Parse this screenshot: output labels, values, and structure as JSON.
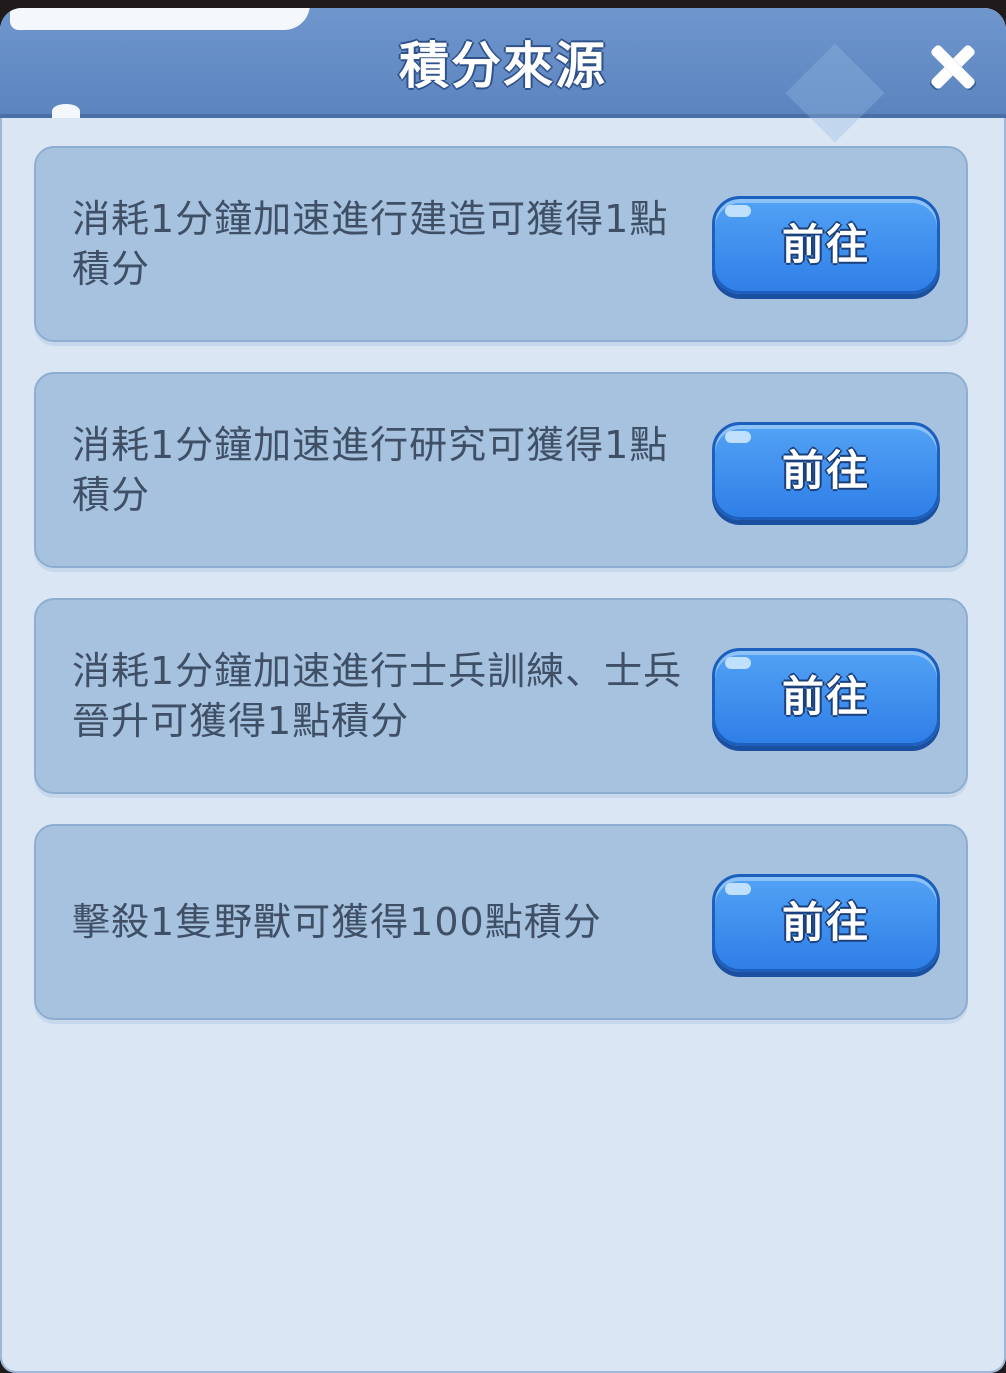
{
  "dialog": {
    "title": "積分來源",
    "close_icon": "close-icon"
  },
  "rows": [
    {
      "text": "消耗1分鐘加速進行建造可獲得1點積分",
      "button_label": "前往"
    },
    {
      "text": "消耗1分鐘加速進行研究可獲得1點積分",
      "button_label": "前往"
    },
    {
      "text": "消耗1分鐘加速進行士兵訓練、士兵晉升可獲得1點積分",
      "button_label": "前往"
    },
    {
      "text": "擊殺1隻野獸可獲得100點積分",
      "button_label": "前往"
    }
  ],
  "colors": {
    "header": "#6f96cd",
    "panel": "#dbe6f4",
    "row": "#a6c2df",
    "button": "#3d8ff0"
  }
}
